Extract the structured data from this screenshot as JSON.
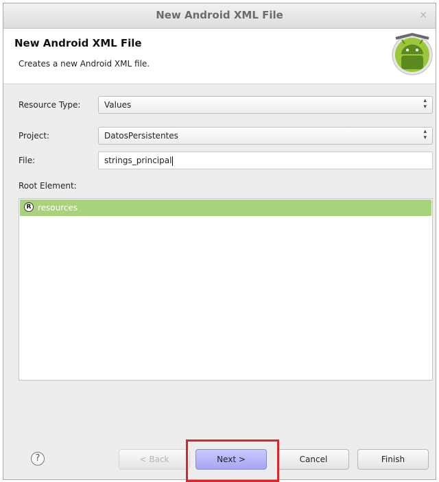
{
  "window": {
    "title": "New Android XML File",
    "close_glyph": "×"
  },
  "header": {
    "title": "New Android XML File",
    "description": "Creates a new Android XML file.",
    "logo_icon": "android-logo-icon"
  },
  "form": {
    "resource_type_label": "Resource Type:",
    "resource_type_value": "Values",
    "project_label": "Project:",
    "project_value": "DatosPersistentes",
    "file_label": "File:",
    "file_value": "strings_principal",
    "root_element_label": "Root Element:"
  },
  "root_elements": {
    "items": [
      {
        "label": "resources",
        "icon_letter": "R",
        "selected": true
      }
    ]
  },
  "buttons": {
    "help": "?",
    "back": "< Back",
    "next": "Next >",
    "cancel": "Cancel",
    "finish": "Finish"
  },
  "colors": {
    "selection": "#a9d37a",
    "highlight": "#d8262c",
    "android_green": "#9bc83a"
  }
}
